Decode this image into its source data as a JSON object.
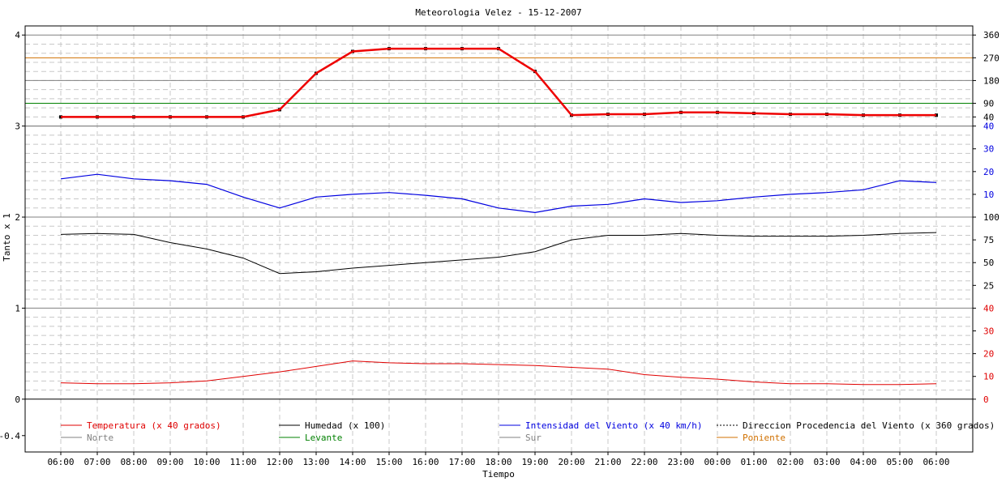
{
  "chart_data": {
    "type": "line",
    "title": "Meteorologia Velez - 15-12-2007",
    "xlabel": "Tiempo",
    "ylabel": "Tanto x 1",
    "x_ticks": [
      "06:00",
      "07:00",
      "08:00",
      "09:00",
      "10:00",
      "11:00",
      "12:00",
      "13:00",
      "14:00",
      "15:00",
      "16:00",
      "17:00",
      "18:00",
      "19:00",
      "20:00",
      "21:00",
      "22:00",
      "23:00",
      "00:00",
      "01:00",
      "02:00",
      "03:00",
      "04:00",
      "05:00",
      "06:00"
    ],
    "y_ticks": [
      "-0.4",
      "0",
      "1",
      "2",
      "3",
      "4"
    ],
    "ylim": [
      -0.58,
      4.1
    ],
    "grid": true,
    "legend_position": "bottom",
    "right_axis_labels": {
      "direccion": [
        "40",
        "90",
        "180",
        "270",
        "360"
      ],
      "intensidad": [
        "10",
        "20",
        "30",
        "40"
      ],
      "humedad": [
        "25",
        "50",
        "75",
        "100"
      ],
      "temperatura": [
        "0",
        "10",
        "20",
        "30",
        "40"
      ]
    },
    "reference_lines": [
      {
        "name": "Norte",
        "value": 3.0,
        "color": "#808080"
      },
      {
        "name": "Levante",
        "value": 3.25,
        "color": "#008000"
      },
      {
        "name": "Sur",
        "value": 3.5,
        "color": "#808080"
      },
      {
        "name": "Poniente",
        "value": 3.75,
        "color": "#d07000"
      }
    ],
    "series": [
      {
        "name": "Temperatura (x 40 grados)",
        "color": "#e00000",
        "style": "solid",
        "values": [
          0.18,
          0.17,
          0.17,
          0.18,
          0.2,
          0.25,
          0.3,
          0.36,
          0.42,
          0.4,
          0.39,
          0.39,
          0.38,
          0.37,
          0.35,
          0.33,
          0.27,
          0.24,
          0.22,
          0.19,
          0.17,
          0.17,
          0.16,
          0.16,
          0.17
        ]
      },
      {
        "name": "Humedad (x 100)",
        "color": "#000000",
        "style": "solid",
        "values": [
          1.81,
          1.82,
          1.81,
          1.72,
          1.65,
          1.55,
          1.38,
          1.4,
          1.44,
          1.47,
          1.5,
          1.53,
          1.56,
          1.62,
          1.75,
          1.8,
          1.8,
          1.82,
          1.8,
          1.79,
          1.79,
          1.79,
          1.8,
          1.82,
          1.83
        ]
      },
      {
        "name": "Intensidad del Viento (x 40 km/h)",
        "color": "#0000e0",
        "style": "solid",
        "values": [
          2.42,
          2.47,
          2.42,
          2.4,
          2.36,
          2.22,
          2.1,
          2.22,
          2.25,
          2.27,
          2.24,
          2.2,
          2.1,
          2.05,
          2.12,
          2.14,
          2.2,
          2.16,
          2.18,
          2.22,
          2.25,
          2.27,
          2.3,
          2.4,
          2.38
        ]
      },
      {
        "name": "Direccion Procedencia del Viento (x 360 grados)",
        "color": "#000000",
        "style": "dotted",
        "values": [
          3.1,
          3.1,
          3.1,
          3.1,
          3.1,
          3.1,
          3.18,
          3.58,
          3.82,
          3.85,
          3.85,
          3.85,
          3.85,
          3.6,
          3.12,
          3.13,
          3.13,
          3.15,
          3.15,
          3.14,
          3.13,
          3.13,
          3.12,
          3.12,
          3.12
        ]
      },
      {
        "name": "Norte",
        "color": "#808080",
        "style": "solid",
        "values": []
      },
      {
        "name": "Levante",
        "color": "#008000",
        "style": "solid",
        "values": []
      },
      {
        "name": "Sur",
        "color": "#808080",
        "style": "solid",
        "values": []
      },
      {
        "name": "Poniente",
        "color": "#d07000",
        "style": "solid",
        "values": []
      }
    ],
    "direccion_trend": {
      "color": "#ee0000",
      "values": [
        3.1,
        3.1,
        3.1,
        3.1,
        3.1,
        3.1,
        3.18,
        3.58,
        3.82,
        3.85,
        3.85,
        3.85,
        3.85,
        3.6,
        3.12,
        3.13,
        3.13,
        3.15,
        3.15,
        3.14,
        3.13,
        3.13,
        3.12,
        3.12,
        3.12
      ]
    }
  }
}
